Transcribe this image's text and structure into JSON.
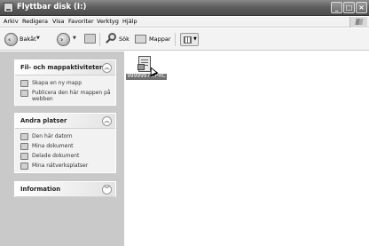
{
  "window": {
    "title": "Flyttbar disk (I:)",
    "controls": [
      "_",
      "□",
      "×"
    ]
  },
  "menu": {
    "items": [
      "Arkiv",
      "Redigera",
      "Visa",
      "Favoriter",
      "Verktyg",
      "Hjälp"
    ]
  },
  "toolbar": {
    "back_label": "Bakåt",
    "search_label": "Sök",
    "folders_label": "Mappar"
  },
  "taskpane": {
    "file_tasks": {
      "title": "Fil- och mappaktiviteter",
      "items": [
        "Skapa en ny mapp",
        "Publicera den här mappen på webben"
      ]
    },
    "other_places": {
      "title": "Andra platser",
      "items": [
        "Den här datorn",
        "Mina dokument",
        "Delade dokument",
        "Mina nätverksplatser"
      ]
    },
    "information": {
      "title": "Information"
    }
  },
  "files": [
    {
      "name": "99999976.PHC",
      "selected": true,
      "icon": "file-icon"
    }
  ]
}
